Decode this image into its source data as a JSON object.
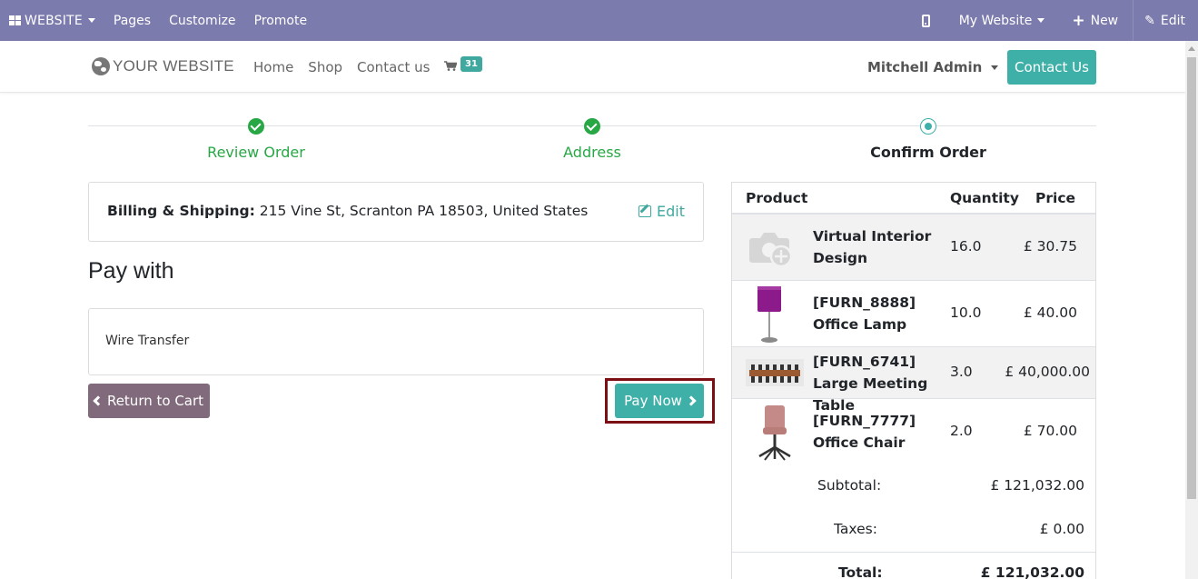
{
  "editor_bar": {
    "brand": "WEBSITE",
    "items": [
      "Pages",
      "Customize",
      "Promote"
    ],
    "website_selector": "My Website",
    "new_label": "New",
    "edit_label": "Edit"
  },
  "header": {
    "logo_text": "YOUR WEBSITE",
    "nav": [
      "Home",
      "Shop",
      "Contact us"
    ],
    "cart_count": "31",
    "user": "Mitchell Admin",
    "contact_button": "Contact Us"
  },
  "wizard": {
    "steps": [
      {
        "label": "Review Order",
        "state": "done"
      },
      {
        "label": "Address",
        "state": "done"
      },
      {
        "label": "Confirm Order",
        "state": "current"
      }
    ]
  },
  "billing": {
    "label": "Billing & Shipping:",
    "address": "215 Vine St, Scranton PA 18503, United States",
    "edit_label": "Edit"
  },
  "payment": {
    "heading": "Pay with",
    "option": "Wire Transfer",
    "return_label": "Return to Cart",
    "pay_label": "Pay Now"
  },
  "summary": {
    "headers": {
      "product": "Product",
      "quantity": "Quantity",
      "price": "Price"
    },
    "lines": [
      {
        "name": "Virtual Interior Design",
        "qty": "16.0",
        "price": "£ 30.75"
      },
      {
        "name": "[FURN_8888] Office Lamp",
        "qty": "10.0",
        "price": "£ 40.00"
      },
      {
        "name": "[FURN_6741] Large Meeting Table",
        "qty": "3.0",
        "price": "£ 40,000.00"
      },
      {
        "name": "[FURN_7777] Office Chair",
        "qty": "2.0",
        "price": "£ 70.00"
      }
    ],
    "subtotal_label": "Subtotal:",
    "subtotal": "£ 121,032.00",
    "taxes_label": "Taxes:",
    "taxes": "£ 0.00",
    "total_label": "Total:",
    "total": "£ 121,032.00"
  },
  "colors": {
    "editor_bar": "#7c7bad",
    "primary": "#3fb0a8",
    "secondary": "#806a7b",
    "success": "#28a745",
    "highlight": "#7b0f14"
  }
}
